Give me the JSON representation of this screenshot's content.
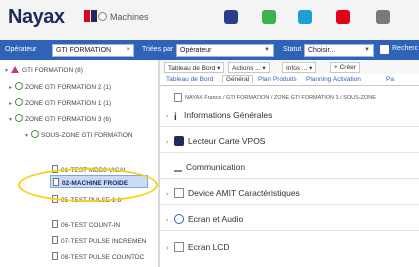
{
  "header": {
    "logo": "Nayax",
    "module": "Machines"
  },
  "filters": {
    "operator_label": "Opérateur",
    "operator_value": "GTI FORMATION",
    "operator_clear": "×",
    "sort_label": "Triées par",
    "sort_value": "Opérateur",
    "status_label": "Statut",
    "status_value": "Choisir...",
    "search_label": "Recherc"
  },
  "tree": {
    "nodes": [
      {
        "label": "GTI FORMATION (8)"
      },
      {
        "label": "ZONE GTI FORMATION 2 (1)"
      },
      {
        "label": "ZONE GTI FORMATION 1 (1)"
      },
      {
        "label": "ZONE GTI FORMATION 3 (6)"
      },
      {
        "label": "SOUS-ZONE GTI FORMATION"
      },
      {
        "label": "01-TEST MDB3 VICAL"
      },
      {
        "label": "02-MACHINE FROIDE"
      },
      {
        "label": "05-TEST PULSE 1-8"
      },
      {
        "label": "06-TEST COUNT-IN"
      },
      {
        "label": "07-TEST PULSE INCREMEN"
      },
      {
        "label": "08-TEST PULSE COUNTDC"
      }
    ]
  },
  "toolbar": {
    "dashboard_btn": "Tableau de Bord",
    "actions_btn": "Actions ...",
    "infos_btn": "Infos ...",
    "create_btn": "Créer"
  },
  "tabs": [
    "Tableau de Bord",
    "Général",
    "Plan Produits",
    "Planning Activation",
    "Pa"
  ],
  "breadcrumb": "NAYAX France / GTI FORMATION / ZONE GTI FORMATION 3 / SOUS-ZONE",
  "sections": [
    "Informations Générales",
    "Lecteur Carte VPOS",
    "Communication",
    "Device AMIT Caractéristiques",
    "Ecran et Audio",
    "Ecran LCD"
  ],
  "colors": {
    "filterbar": "#2e63b8",
    "highlight_ring": "#f5d214",
    "selection": "#c9dcf6"
  }
}
